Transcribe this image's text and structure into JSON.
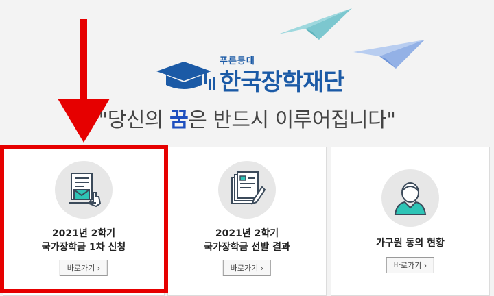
{
  "logo": {
    "sub": "푸른등대",
    "main": "한국장학재단"
  },
  "slogan": {
    "open": "\"당신의 ",
    "dream": "꿈",
    "close": "은 반드시 이루어집니다\""
  },
  "cards": [
    {
      "icon": "document-mail-click-icon",
      "title_line1": "2021년 2학기",
      "title_line2": "국가장학금 1차 신청",
      "button": "바로가기  ›"
    },
    {
      "icon": "documents-pen-icon",
      "title_line1": "2021년 2학기",
      "title_line2": "국가장학금 선발 결과",
      "button": "바로가기  ›"
    },
    {
      "icon": "person-icon",
      "title_line1": "가구원 동의 현황",
      "button": "바로가기  ›"
    }
  ],
  "colors": {
    "brand": "#1b5aa6",
    "highlight": "#e60000",
    "background": "#f3f3f3"
  }
}
